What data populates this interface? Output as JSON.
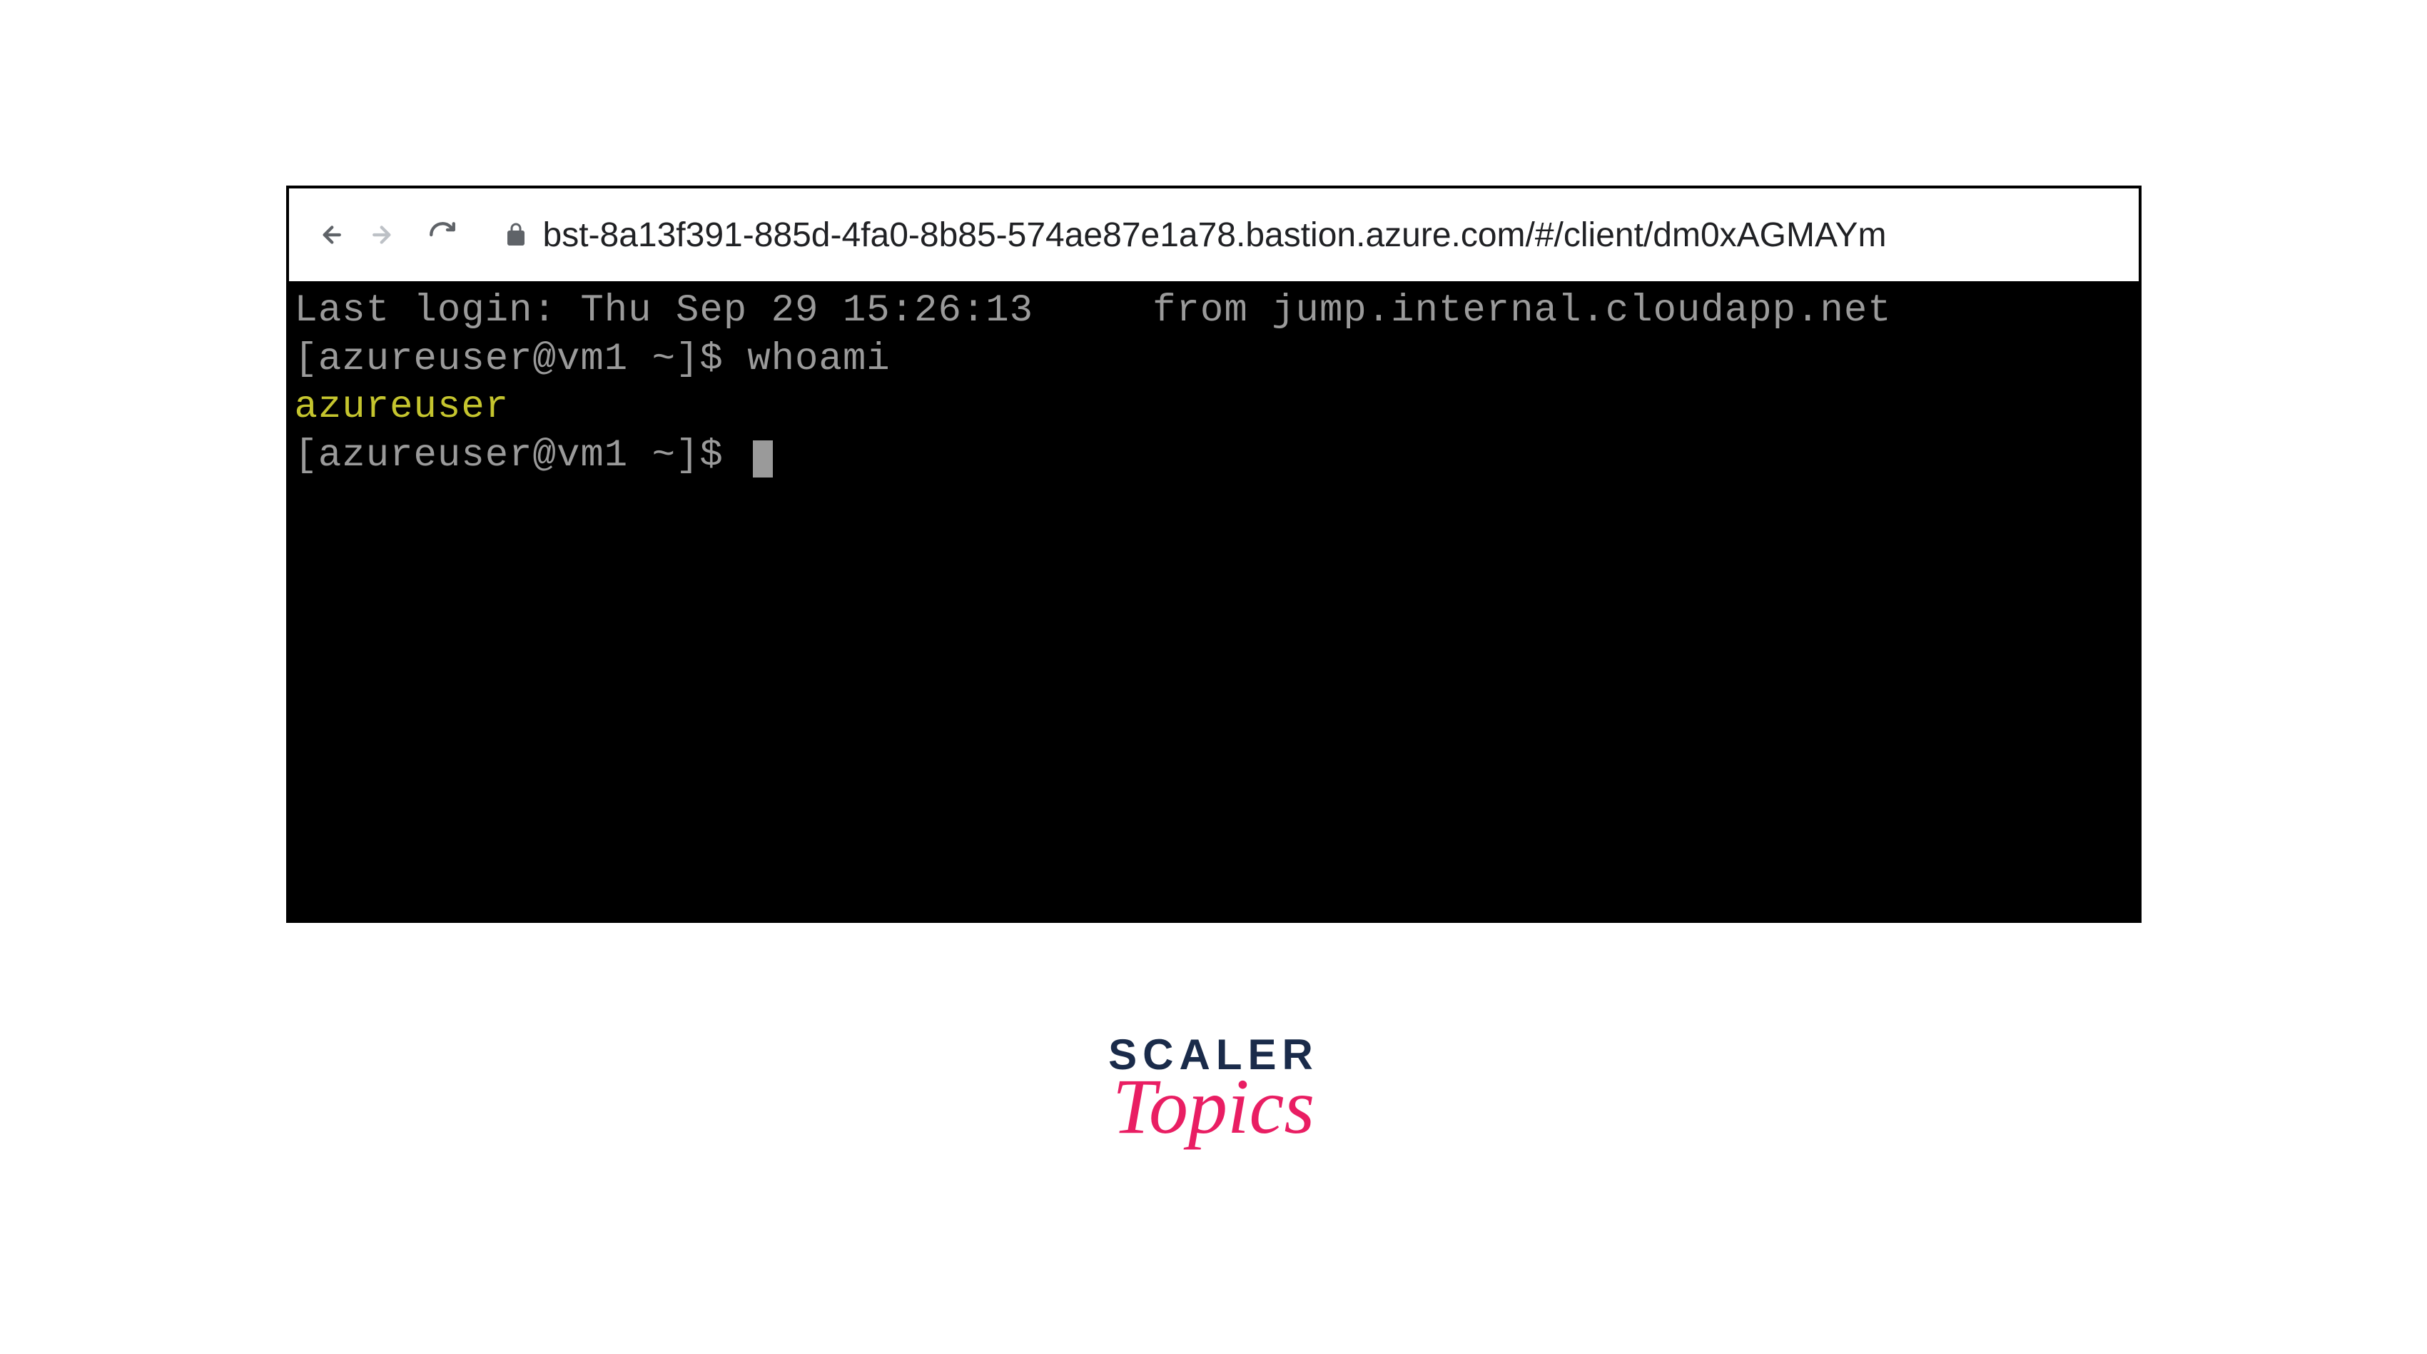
{
  "browser": {
    "url": "bst-8a13f391-885d-4fa0-8b85-574ae87e1a78.bastion.azure.com/#/client/dm0xAGMAYm"
  },
  "terminal": {
    "line1_part1": "Last login: Thu Sep 29 15:26:13",
    "line1_part2": "from jump.internal.cloudapp.net",
    "prompt1": "[azureuser@vm1 ~]$ ",
    "command1": "whoami",
    "output1": "azureuser",
    "prompt2": "[azureuser@vm1 ~]$ "
  },
  "logo": {
    "line1": "SCALER",
    "line2": "Topics"
  }
}
